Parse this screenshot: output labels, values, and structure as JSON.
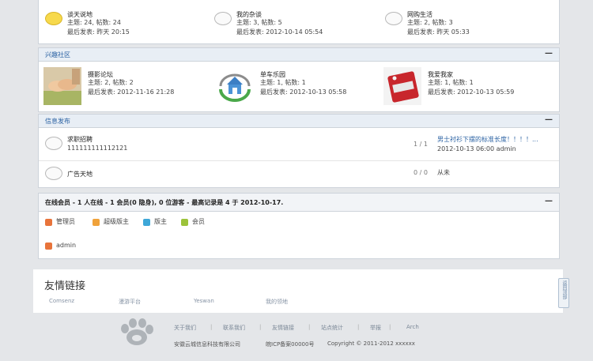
{
  "forum_top": [
    {
      "name": "谈天说地",
      "stats": "主题: 24, 帖数: 24",
      "last": "最后发表: 昨天 20:15",
      "icon": "bubble-new-icon"
    },
    {
      "name": "我的杂谈",
      "stats": "主题: 3, 帖数: 5",
      "last": "最后发表: 2012-10-14 05:54",
      "icon": "bubble-icon"
    },
    {
      "name": "网购生活",
      "stats": "主题: 2, 帖数: 3",
      "last": "最后发表: 昨天 05:33",
      "icon": "bubble-icon"
    }
  ],
  "interest": {
    "title": "兴趣社区",
    "collapse": "—",
    "forums": [
      {
        "name": "摄影论坛",
        "stats": "主题: 2, 帖数: 2",
        "last": "最后发表: 2012-11-16 21:28",
        "icon": "hands-photo-icon"
      },
      {
        "name": "单车乐园",
        "stats": "主题: 1, 帖数: 1",
        "last": "最后发表: 2012-10-13 05:58",
        "icon": "house-recycle-icon"
      },
      {
        "name": "我爱我家",
        "stats": "主题: 1, 帖数: 1",
        "last": "最后发表: 2012-10-13 05:59",
        "icon": "sale-tag-icon"
      }
    ]
  },
  "info": {
    "title": "信息发布",
    "collapse": "—",
    "rows": [
      {
        "name": "求职招聘",
        "desc": "111111111112121",
        "count": "1 / 1",
        "last_title": "男士衬衫下摆的标准长度！！！！...",
        "last_meta": "2012-10-13 06:00 admin"
      },
      {
        "name": "广告天地",
        "desc": "",
        "count": "0 / 0",
        "last_title": "",
        "last_meta": "从未"
      }
    ]
  },
  "online": {
    "title": "在线会员 - 1 人在线 - 1 会员(0 隐身), 0 位游客 - 最高记录是 4 于 2012-10-17.",
    "collapse": "—",
    "legend": [
      {
        "label": "管理员",
        "color": "#e8743b"
      },
      {
        "label": "超级版主",
        "color": "#f0a23a"
      },
      {
        "label": "版主",
        "color": "#3ea7d8"
      },
      {
        "label": "会员",
        "color": "#9cc33a"
      }
    ],
    "user": "admin",
    "user_color": "#e8743b"
  },
  "links": {
    "title": "友情链接",
    "items": [
      "Comsenz",
      "漫游平台",
      "Yeswan",
      "我的领地"
    ]
  },
  "side_tab": "返回顶部",
  "footer": {
    "links": [
      "关于我们",
      "联系我们",
      "友情链接",
      "站点统计",
      "举报",
      "Arch"
    ],
    "company": "安徽云城信息科技有限公司",
    "icp": "皖ICP备案00000号",
    "copyright": "Copyright © 2011-2012 xxxxxx"
  }
}
